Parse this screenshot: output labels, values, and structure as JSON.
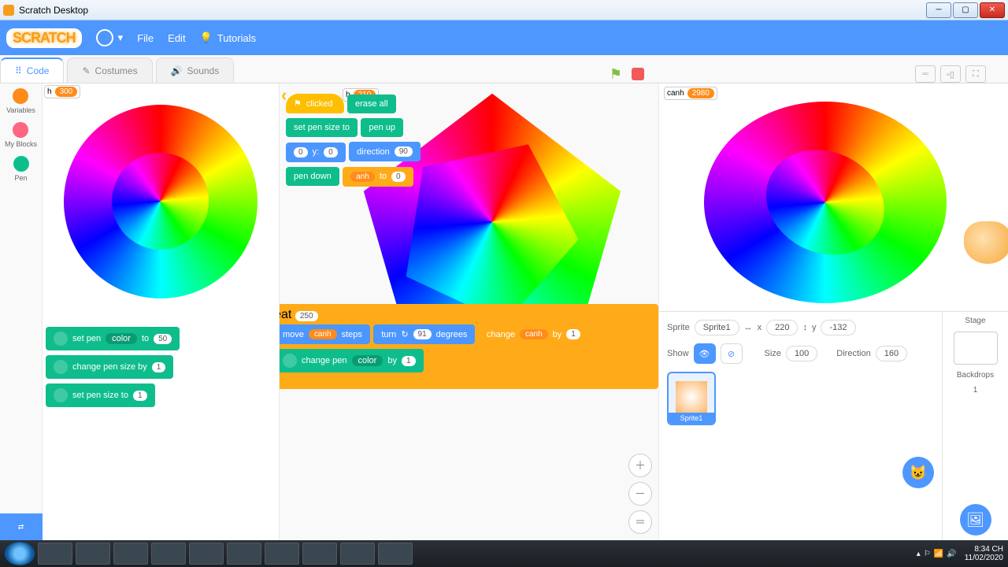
{
  "window": {
    "title": "Scratch Desktop"
  },
  "menubar": {
    "file": "File",
    "edit": "Edit",
    "tutorials": "Tutorials",
    "logo": "SCRATCH"
  },
  "tabs": {
    "code": "Code",
    "costumes": "Costumes",
    "sounds": "Sounds"
  },
  "monitors": {
    "palette": {
      "name": "h",
      "value": "300"
    },
    "script": {
      "name": "h",
      "value": "210"
    },
    "stage": {
      "name": "canh",
      "value": "2980"
    }
  },
  "palette_blocks": {
    "setpencolor": "set pen",
    "color": "color",
    "to": "to",
    "setpencolorval": "50",
    "changepensize": "change pen size by",
    "changepensizeval": "1",
    "setpensize": "set pen size to",
    "setpensizeval": "1"
  },
  "categories": {
    "variables": "Variables",
    "myblocks": "My Blocks",
    "pen": "Pen"
  },
  "script_blocks": {
    "whenclicked": "clicked",
    "eraseall": "erase all",
    "setpensizeto": "set pen size to",
    "penup": "pen up",
    "goto_x": "0",
    "goto_y_lbl": "y:",
    "goto_y": "0",
    "direction_lbl": "direction",
    "direction": "90",
    "pendown": "pen down",
    "setvar_lbl": "anh",
    "setvar_to": "to",
    "setvar_val": "0",
    "repeat": "repeat",
    "repeat_n": "250",
    "move": "move",
    "move_var": "canh",
    "steps": "steps",
    "turn": "turn",
    "turn_deg": "91",
    "degrees": "degrees",
    "change": "change",
    "change_var": "canh",
    "by": "by",
    "change_val": "1",
    "changepen": "change pen",
    "color": "color",
    "changepenval": "1"
  },
  "sprite": {
    "label": "Sprite",
    "name": "Sprite1",
    "x_lbl": "x",
    "x": "220",
    "y_lbl": "y",
    "y": "-132",
    "show": "Show",
    "size_lbl": "Size",
    "size": "100",
    "dir_lbl": "Direction",
    "dir": "160"
  },
  "stagepanel": {
    "stage": "Stage",
    "backdrops": "Backdrops",
    "backdrops_n": "1"
  },
  "taskbar": {
    "time": "8:34 CH",
    "date": "11/02/2020"
  }
}
